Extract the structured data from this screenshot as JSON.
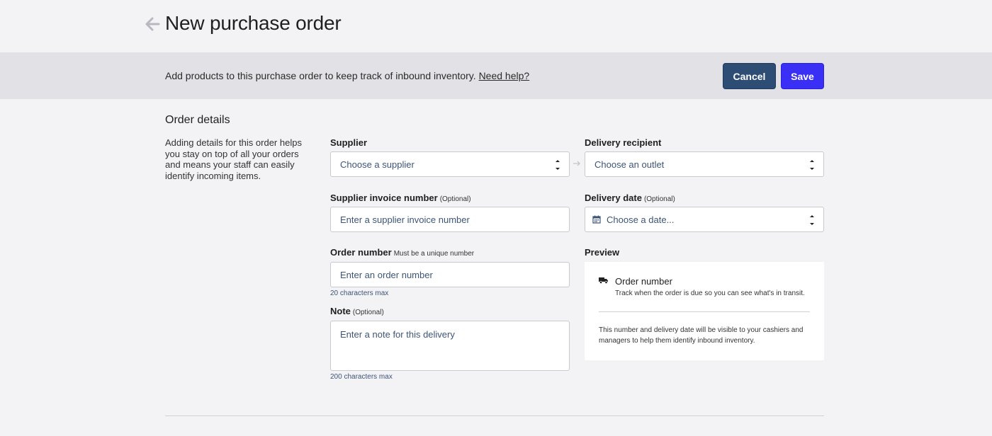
{
  "header": {
    "title": "New purchase order",
    "back_icon": "arrow-left-icon"
  },
  "banner": {
    "text": "Add products to this purchase order to keep track of inbound inventory.",
    "help_link": "Need help?",
    "cancel_label": "Cancel",
    "save_label": "Save"
  },
  "section": {
    "title": "Order details",
    "description": "Adding details for this order helps you stay on top of all your orders and means your staff can easily identify incoming items."
  },
  "form": {
    "supplier": {
      "label": "Supplier",
      "placeholder": "Choose a supplier"
    },
    "delivery_recipient": {
      "label": "Delivery recipient",
      "placeholder": "Choose an outlet"
    },
    "supplier_invoice": {
      "label": "Supplier invoice number",
      "optional": "(Optional)",
      "placeholder": "Enter a supplier invoice number"
    },
    "delivery_date": {
      "label": "Delivery date",
      "optional": "(Optional)",
      "placeholder": "Choose a date..."
    },
    "order_number": {
      "label": "Order number",
      "note": "Must be a unique number",
      "placeholder": "Enter an order number",
      "hint": "20 characters max"
    },
    "note": {
      "label": "Note",
      "optional": "(Optional)",
      "placeholder": "Enter a note for this delivery",
      "hint": "200 characters max"
    }
  },
  "preview": {
    "label": "Preview",
    "title": "Order number",
    "subtitle": "Track when the order is due so you can see what's in transit.",
    "note": "This number and delivery date will be visible to your cashiers and managers to help them identify inbound inventory."
  },
  "colors": {
    "primary": "#3a2ff5",
    "secondary": "#2d4d75",
    "input_text": "#3c5577"
  }
}
